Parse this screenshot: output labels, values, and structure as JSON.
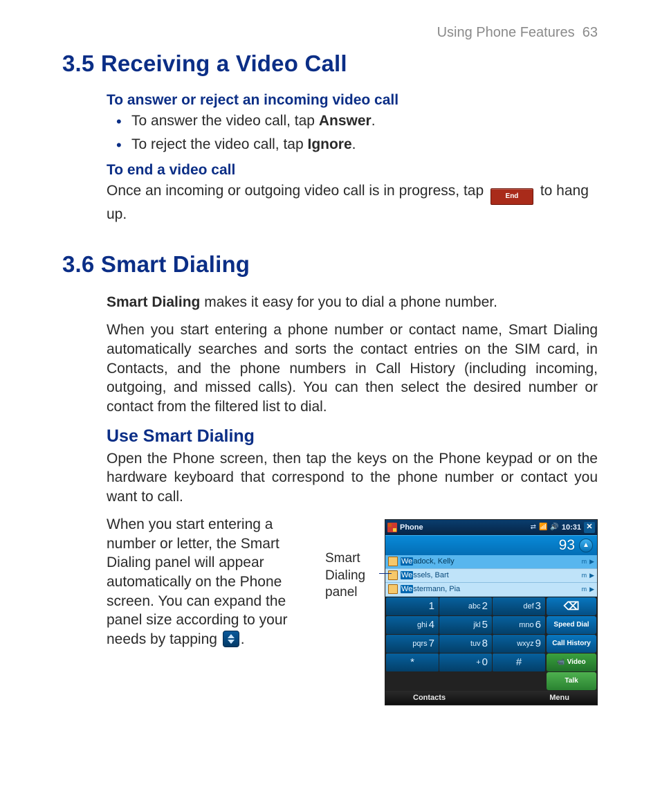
{
  "header": {
    "section": "Using Phone Features",
    "page": "63"
  },
  "s35": {
    "title": "3.5  Receiving a Video Call",
    "sub1": "To answer or reject an incoming video call",
    "b1_pre": "To answer the video call, tap ",
    "b1_bold": "Answer",
    "b1_post": ".",
    "b2_pre": "To reject the video call, tap ",
    "b2_bold": "Ignore",
    "b2_post": ".",
    "sub2": "To end a video call",
    "end_pre": "Once an incoming or outgoing video call is in progress, tap ",
    "end_btn": "End",
    "end_post": " to hang up."
  },
  "s36": {
    "title": "3.6  Smart Dialing",
    "p1_bold": "Smart Dialing",
    "p1_rest": " makes it easy for you to dial a phone number.",
    "p2": "When you start entering a phone number or contact name, Smart Dialing automatically searches and sorts the contact entries on the SIM card, in Contacts, and the phone numbers in Call History (including incoming, outgoing, and missed calls). You can then select the desired number or contact from the filtered list to dial.",
    "sub": "Use Smart Dialing",
    "p3": "Open the Phone screen, then tap the keys on the Phone keypad or on the hardware keyboard that correspond to the phone number or contact you want to call.",
    "p4_pre": "When you start entering a number or letter, the Smart Dialing panel will appear automatically on the Phone screen. You can expand the panel size according to your needs by tapping  ",
    "p4_post": "."
  },
  "callout": {
    "l1": "Smart",
    "l2": "Dialing",
    "l3": "panel"
  },
  "phone": {
    "title": "Phone",
    "time": "10:31",
    "display": "93",
    "contacts": [
      {
        "pre": "We",
        "rest": "adock, Kelly",
        "tag": "m"
      },
      {
        "pre": "We",
        "rest": "ssels, Bart",
        "tag": "m"
      },
      {
        "pre": "We",
        "rest": "stermann, Pia",
        "tag": "m"
      }
    ],
    "keys": [
      {
        "sub": "",
        "d": "1"
      },
      {
        "sub": "abc",
        "d": "2"
      },
      {
        "sub": "def",
        "d": "3"
      },
      {
        "sub": "ghi",
        "d": "4"
      },
      {
        "sub": "jkl",
        "d": "5"
      },
      {
        "sub": "mno",
        "d": "6"
      },
      {
        "sub": "pqrs",
        "d": "7"
      },
      {
        "sub": "tuv",
        "d": "8"
      },
      {
        "sub": "wxyz",
        "d": "9"
      },
      {
        "sub": "*",
        "d": ""
      },
      {
        "sub": "+",
        "d": "0"
      },
      {
        "sub": "#",
        "d": ""
      }
    ],
    "side": {
      "speed": "Speed Dial",
      "history": "Call History",
      "video": "Video",
      "talk": "Talk"
    },
    "bottom": {
      "left": "Contacts",
      "right": "Menu"
    }
  }
}
